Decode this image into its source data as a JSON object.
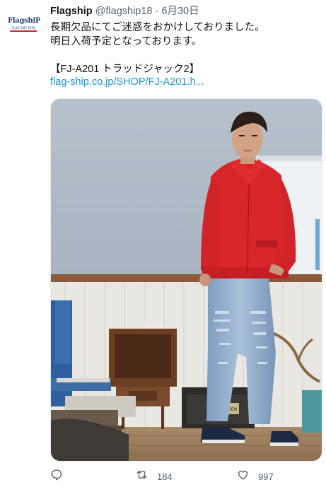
{
  "tweet": {
    "display_name": "Flagship",
    "handle": "@flagship18",
    "separator": "·",
    "date": "6月30日",
    "body_lines": [
      "長期欠品にてご迷惑をおかけしておりました。",
      "明日入荷予定となっております。",
      "",
      "【FJ-A201 トラッドジャック2】"
    ],
    "link_text": "flag-ship.co.jp/SHOP/FJ-A201.h...",
    "avatar_logo": {
      "word": "FlagshiP",
      "sub": "FLAG SHIP 1978",
      "color": "#1e3a6e"
    },
    "photo": {
      "subject": "man in red jacket and ripped jeans",
      "sign_text": "TOKE-SEN"
    },
    "actions": {
      "reply_icon": "reply-icon",
      "retweet_icon": "retweet-icon",
      "retweet_count": "184",
      "like_icon": "heart-icon",
      "like_count": "997"
    },
    "colors": {
      "link": "#1b95e0",
      "meta": "#536471",
      "jacket": "#d8252a"
    }
  }
}
